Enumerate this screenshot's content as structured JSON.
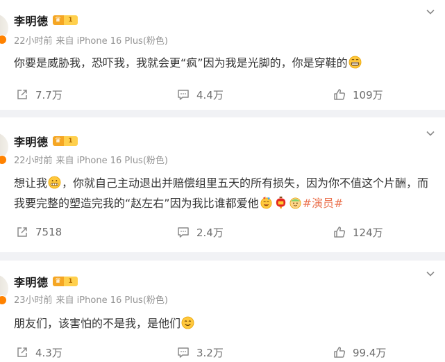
{
  "posts": [
    {
      "user": {
        "name": "李明德",
        "vip_level": "1"
      },
      "meta": {
        "time": "22小时前",
        "source": "来自 iPhone 16 Plus(粉色)"
      },
      "text": {
        "part1": "你要是威胁我，恐吓我，我就会更“疯”因为我是光脚的，你是穿鞋的"
      },
      "emojis": [
        "grin-emoji"
      ],
      "stats": {
        "reposts": "7.7万",
        "comments": "4.4万",
        "likes": "109万"
      }
    },
    {
      "user": {
        "name": "李明德",
        "vip_level": "1"
      },
      "meta": {
        "time": "22小时前",
        "source": "来自 iPhone 16 Plus(粉色)"
      },
      "text": {
        "part1": "想让我",
        "part2": "，你就自己主动退出并赔偿组里五天的所有损失，因为你不值这个片酬，而我要完整的塑造完我的“赵左右”因为我比谁都爱他",
        "topic": "#演员#"
      },
      "emojis": [
        "zipper-mouth-emoji",
        "party-emoji",
        "lantern-emoji",
        "cake-emoji"
      ],
      "stats": {
        "reposts": "7518",
        "comments": "2.4万",
        "likes": "124万"
      }
    },
    {
      "user": {
        "name": "李明德",
        "vip_level": "1"
      },
      "meta": {
        "time": "23小时前",
        "source": "来自 iPhone 16 Plus(粉色)"
      },
      "text": {
        "part1": "朋友们，该害怕的不是我，是他们"
      },
      "emojis": [
        "smile-emoji"
      ],
      "stats": {
        "reposts": "4.3万",
        "comments": "3.2万",
        "likes": "99.4万"
      }
    }
  ],
  "colors": {
    "background": "#f1f2f5",
    "card": "#ffffff",
    "topic_link": "#eb7350",
    "meta_text": "#939393",
    "action_text": "#6e6e6e",
    "vip_badge": "#ffd04d"
  },
  "icons": [
    "vip-crown-icon",
    "chevron-down-icon",
    "repost-icon",
    "comment-icon",
    "like-icon"
  ]
}
